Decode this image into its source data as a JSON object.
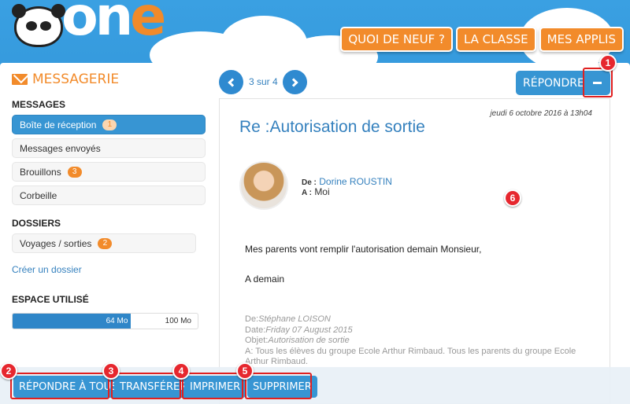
{
  "header": {
    "logo_text": "one",
    "nav": [
      "QUOI DE NEUF ?",
      "LA CLASSE",
      "MES APPLIS"
    ]
  },
  "sidebar": {
    "title": "MESSAGERIE",
    "messages_heading": "MESSAGES",
    "items": [
      {
        "label": "Boîte de réception",
        "badge": "1",
        "active": true
      },
      {
        "label": "Messages envoyés",
        "badge": null,
        "active": false
      },
      {
        "label": "Brouillons",
        "badge": "3",
        "active": false
      },
      {
        "label": "Corbeille",
        "badge": null,
        "active": false
      }
    ],
    "folders_heading": "DOSSIERS",
    "folders": [
      {
        "label": "Voyages / sorties",
        "badge": "2"
      }
    ],
    "create_folder": "Créer un dossier",
    "space_heading": "ESPACE UTILISÉ",
    "space_used": "64 Mo",
    "space_total": "100 Mo",
    "space_fraction": 0.64
  },
  "pager": {
    "text": "3 sur 4"
  },
  "toolbar": {
    "reply": "RÉPONDRE"
  },
  "message": {
    "date": "jeudi 6 octobre 2016 à 13h04",
    "subject": "Re :Autorisation de sortie",
    "from_label": "De :",
    "from_name": "Dorine ROUSTIN",
    "to_label": "A :",
    "to_name": "Moi",
    "body": [
      "Mes parents vont remplir l'autorisation demain Monsieur,",
      "A demain"
    ],
    "quote": {
      "from_label": "De:",
      "from": "Stéphane LOISON",
      "date_label": "Date:",
      "date": "Friday 07 August 2015",
      "subject_label": "Objet:",
      "subject": "Autorisation de sortie",
      "to": "A: Tous les élèves du groupe Ecole Arthur Rimbaud. Tous les parents du groupe Ecole Arthur Rimbaud."
    }
  },
  "actions": [
    "RÉPONDRE À TOUS",
    "TRANSFÉRER",
    "IMPRIMER",
    "SUPPRIMER"
  ],
  "markers": [
    "1",
    "2",
    "3",
    "4",
    "5",
    "6"
  ],
  "colors": {
    "accent_orange": "#f28b2b",
    "primary_blue": "#3795d3",
    "marker_red": "#e6272e"
  }
}
